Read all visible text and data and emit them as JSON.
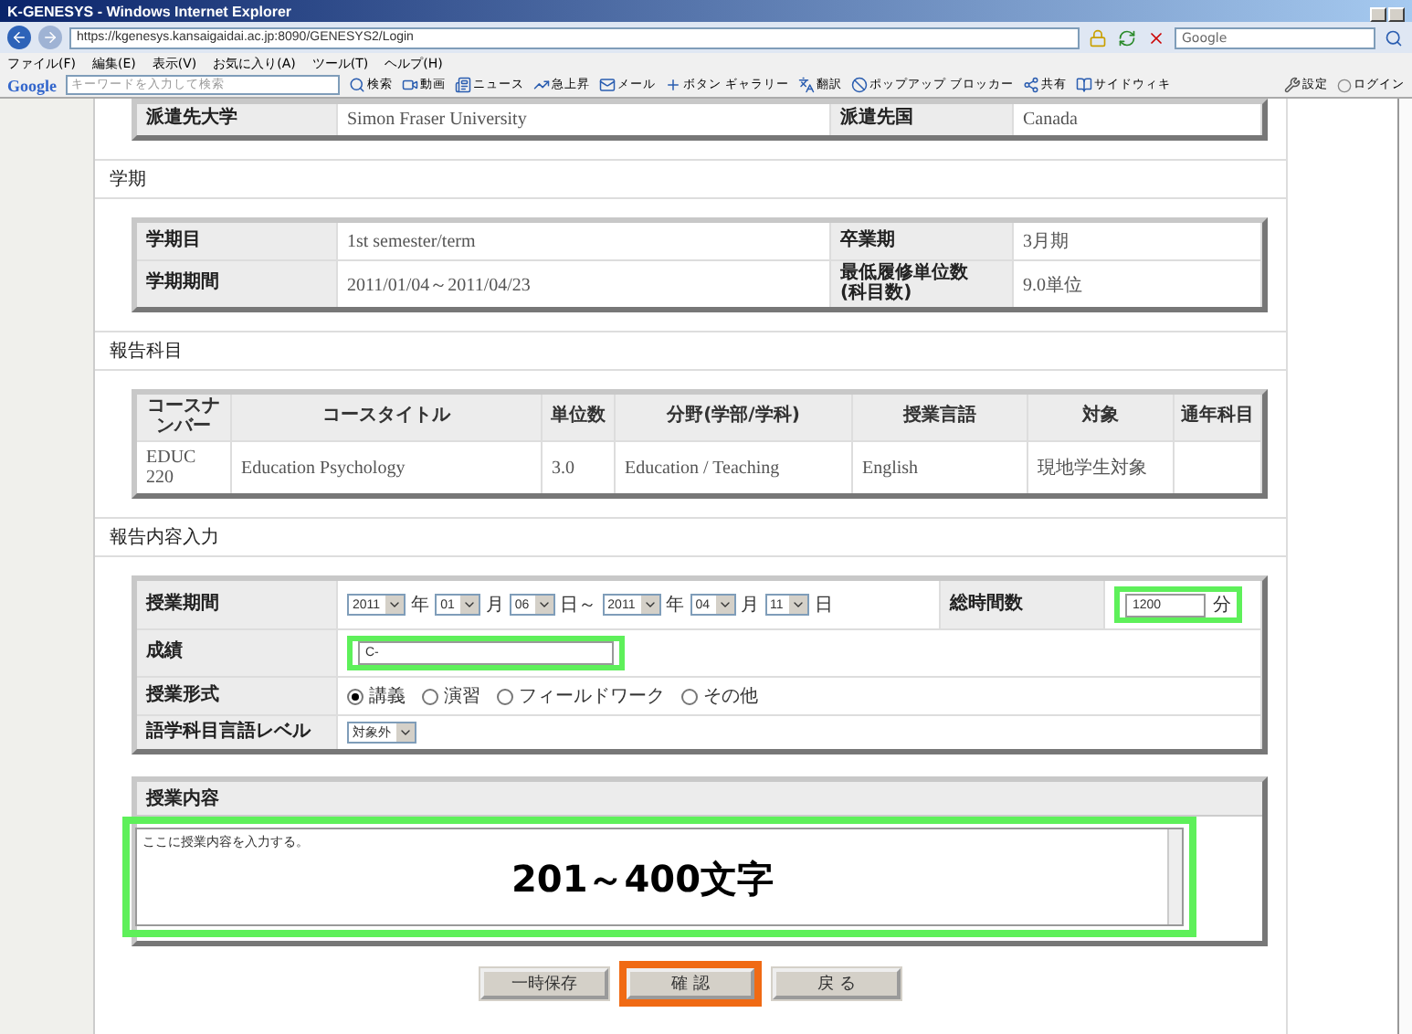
{
  "window": {
    "title": "K-GENESYS - Windows Internet Explorer"
  },
  "address_bar": {
    "url": "https://kgenesys.kansaigaidai.ac.jp:8090/GENESYS2/Login",
    "search_placeholder": "Google"
  },
  "menu": [
    "ファイル(F)",
    "編集(E)",
    "表示(V)",
    "お気に入り(A)",
    "ツール(T)",
    "ヘルプ(H)"
  ],
  "google_toolbar": {
    "logo": "Google",
    "placeholder": "キーワードを入力して検索",
    "items": [
      "検索",
      "動画",
      "ニュース",
      "急上昇",
      "メール",
      "ボタン ギャラリー",
      "翻訳",
      "ポップアップ ブロッカー",
      "共有",
      "サイドウィキ"
    ],
    "settings": "設定",
    "login": "ログイン"
  },
  "destination": {
    "rows": [
      {
        "label": "派遣先大学",
        "value": "Simon Fraser University",
        "label_2": "派遣先国",
        "value_2": "Canada"
      }
    ]
  },
  "term": {
    "heading": "学期",
    "rows": [
      {
        "label": "学期目",
        "value": "1st semester/term",
        "label_2": "卒業期",
        "value_2": "3月期"
      },
      {
        "label": "学期期間",
        "value": "2011/01/04～2011/04/23",
        "label_2": "最低履修単位数\n(科目数)",
        "value_2": "9.0単位"
      }
    ]
  },
  "courses": {
    "heading": "報告科目",
    "columns": [
      "コースナンバー",
      "コースタイトル",
      "単位数",
      "分野(学部/学科)",
      "授業言語",
      "対象",
      "通年科目"
    ],
    "rows": [
      [
        "EDUC 220",
        "Education Psychology",
        "3.0",
        "Education / Teaching",
        "English",
        "現地学生対象",
        ""
      ]
    ]
  },
  "report": {
    "heading": "報告内容入力",
    "period": {
      "label": "授業期間",
      "parts": [
        {
          "value": "2011",
          "unit": "年"
        },
        {
          "value": "01",
          "unit": "月"
        },
        {
          "value": "06",
          "unit": "日～"
        },
        {
          "value": "2011",
          "unit": "年"
        },
        {
          "value": "04",
          "unit": "月"
        },
        {
          "value": "11",
          "unit": "日"
        }
      ]
    },
    "hours": {
      "label": "総時間数",
      "value": "1200",
      "unit": "分",
      "highlighted": true
    },
    "grade": {
      "label": "成績",
      "value": "C-",
      "highlighted": true
    },
    "format": {
      "label": "授業形式",
      "options": [
        {
          "label": "講義",
          "selected": true
        },
        {
          "label": "演習",
          "selected": false
        },
        {
          "label": "フィールドワーク",
          "selected": false
        },
        {
          "label": "その他",
          "selected": false
        }
      ]
    },
    "language_level": {
      "label": "語学科目言語レベル",
      "value": "対象外"
    }
  },
  "content": {
    "heading": "授業内容",
    "value": "ここに授業内容を入力する。",
    "annotation": "201～400文字",
    "highlighted": true
  },
  "buttons": [
    {
      "label": "一時保存",
      "highlighted": false
    },
    {
      "label": "確 認",
      "highlighted": true
    },
    {
      "label": "戻 る",
      "highlighted": false
    }
  ]
}
